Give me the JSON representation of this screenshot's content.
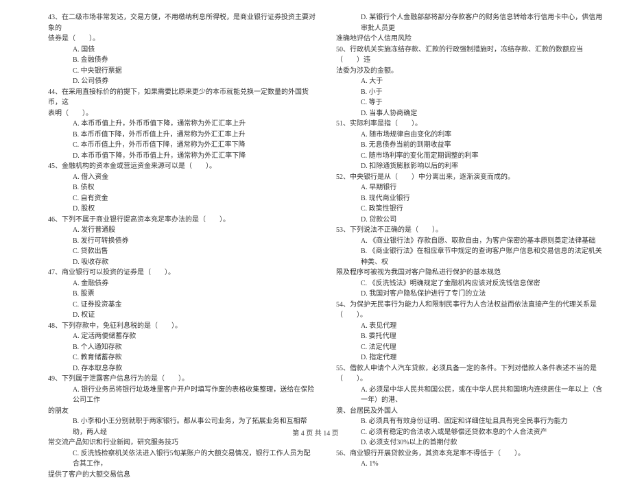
{
  "footer": "第 4 页 共 14 页",
  "left": {
    "q43": {
      "l1": "43、在二级市场非常发达，交易方便，不用缴纳利息所得税，是商业银行证券投资主要对象的",
      "l2": "债券是（　　）。",
      "a": "A. 国债",
      "b": "B. 金融债券",
      "c": "C. 中央银行票据",
      "d": "D. 公司债券"
    },
    "q44": {
      "l1": "44、在采用直接标价的前提下，如果需要比原来更少的本币就能兑换一定数量的外国货币，这",
      "l2": "表明（　　）。",
      "a": "A. 本币币值上升，外币币值下降，通常称为外汇汇率上升",
      "b": "B. 本币币值下降，外币币值上升，通常称为外汇汇率上升",
      "c": "C. 本币币值上升，外币币值下降，通常称为外汇汇率下降",
      "d": "D. 本币币值下降，外币币值上升，通常称为外汇汇率下降"
    },
    "q45": {
      "stem": "45、金融机构的资本金或营运资金来源可以是（　　）。",
      "a": "A. 借入资金",
      "b": "B. 债权",
      "c": "C. 自有资金",
      "d": "D. 股权"
    },
    "q46": {
      "stem": "46、下列不属于商业银行提高资本充足率办法的是（　　）。",
      "a": "A. 发行普通股",
      "b": "B. 发行可转换债券",
      "c": "C. 贷款出售",
      "d": "D. 吸收存款"
    },
    "q47": {
      "stem": "47、商业银行可以投资的证券是（　　）。",
      "a": "A. 金融债券",
      "b": "B. 股票",
      "c": "C. 证券投资基金",
      "d": "D. 权证"
    },
    "q48": {
      "stem": "48、下列存款中，免征利息税的是（　　）。",
      "a": "A. 定活两便储蓄存款",
      "b": "B. 个人通知存款",
      "c": "C. 教育储蓄存款",
      "d": "D. 存本取息存款"
    },
    "q49": {
      "stem": "49、下列属于泄露客户信息行为的是（　　）。",
      "a1": "A. 银行业务员将银行垃圾堆里客户开户时填写作废的表格收集整理，送给在保险公司工作",
      "a2": "的朋友",
      "b1": "B. 小李和小王分别就职于两家银行。都从事公司业务，为了拓展业务和互相帮助，两人经",
      "b2": "常交流产品知识和行业新闻，研究服务技巧",
      "c1": "C. 反洗钱检察机关依法进入银行5旬某账户的大额交易情况，银行工作人员为配合其工作，",
      "c2": "提供了客户的大额交易信息"
    }
  },
  "right": {
    "q49d": {
      "d1": "D. 某银行个人金融部部将部分存款客户的财务信息转给本行信用卡中心，供信用审批人员更",
      "d2": "准确地评估个人信用风险"
    },
    "q50": {
      "l1": "50、行政机关实施冻结存款、汇款的行政强制措施时，冻结存款、汇款的数额应当（　　）违",
      "l2": "法委为涉及的金额。",
      "a": "A. 大于",
      "b": "B. 小于",
      "c": "C. 等于",
      "d": "D. 当事人协商确定"
    },
    "q51": {
      "stem": "51、实际利率是指（　　）。",
      "a": "A. 随市场规律自由变化的利率",
      "b": "B. 无息债券当前的到期收益率",
      "c": "C. 随市场利率的变化而定期调整的利率",
      "d": "D. 扣除通货膨胀影响以后的利率"
    },
    "q52": {
      "stem": "52、中央银行是从（　　）中分离出来，逐渐演变而成的。",
      "a": "A. 早期银行",
      "b": "B. 现代商业银行",
      "c": "C. 政策性银行",
      "d": "D. 贷款公司"
    },
    "q53": {
      "stem": "53、下列说法不正确的是（　　）。",
      "a": "A. 《商业银行法》存款自愿、取款自由，为客户保密的基本原则奠定法律基础",
      "b1": "B. 《商业银行法》在相应章节中规定的查询客户账户信息和交易信息的法定机关种类、权",
      "b2": "限及程序可被视为我国对客户隐私进行保护的基本规范",
      "c": "C. 《反洗钱法》明确规定了金融机构应该对反洗钱信息保密",
      "d": "D. 我国对客户隐私保护进行了专门的立法"
    },
    "q54": {
      "l1": "54、为保护无民事行为能力人和限制民事行为人合法权益而依法直接产生的代理关系是",
      "l2": "（　　）。",
      "a": "A. 表见代理",
      "b": "B. 委托代理",
      "c": "C. 法定代理",
      "d": "D. 指定代理"
    },
    "q55": {
      "l1": "55、借款人申请个人汽车贷款，必须具备一定的条件。下列对借款人条件表述不当的是",
      "l2": "（　　）。",
      "a1": "A. 必须是中华人民共和国公民，或在中华人民共和国境内连续居住一年以上（含一年）的港、",
      "a2": "澳、台居民及外国人",
      "b": "B. 必须具有有效身份证明、固定和详细住址且具有完全民事行为能力",
      "c": "C. 必须有稳定的合法收入或是够偿还贷款本息的个人合法资产",
      "d": "D. 必须支付30%以上的首期付款"
    },
    "q56": {
      "stem": "56、商业银行开展贷款业务，其资本充足率不得低于（　　）。",
      "a": "A. 1%"
    }
  }
}
